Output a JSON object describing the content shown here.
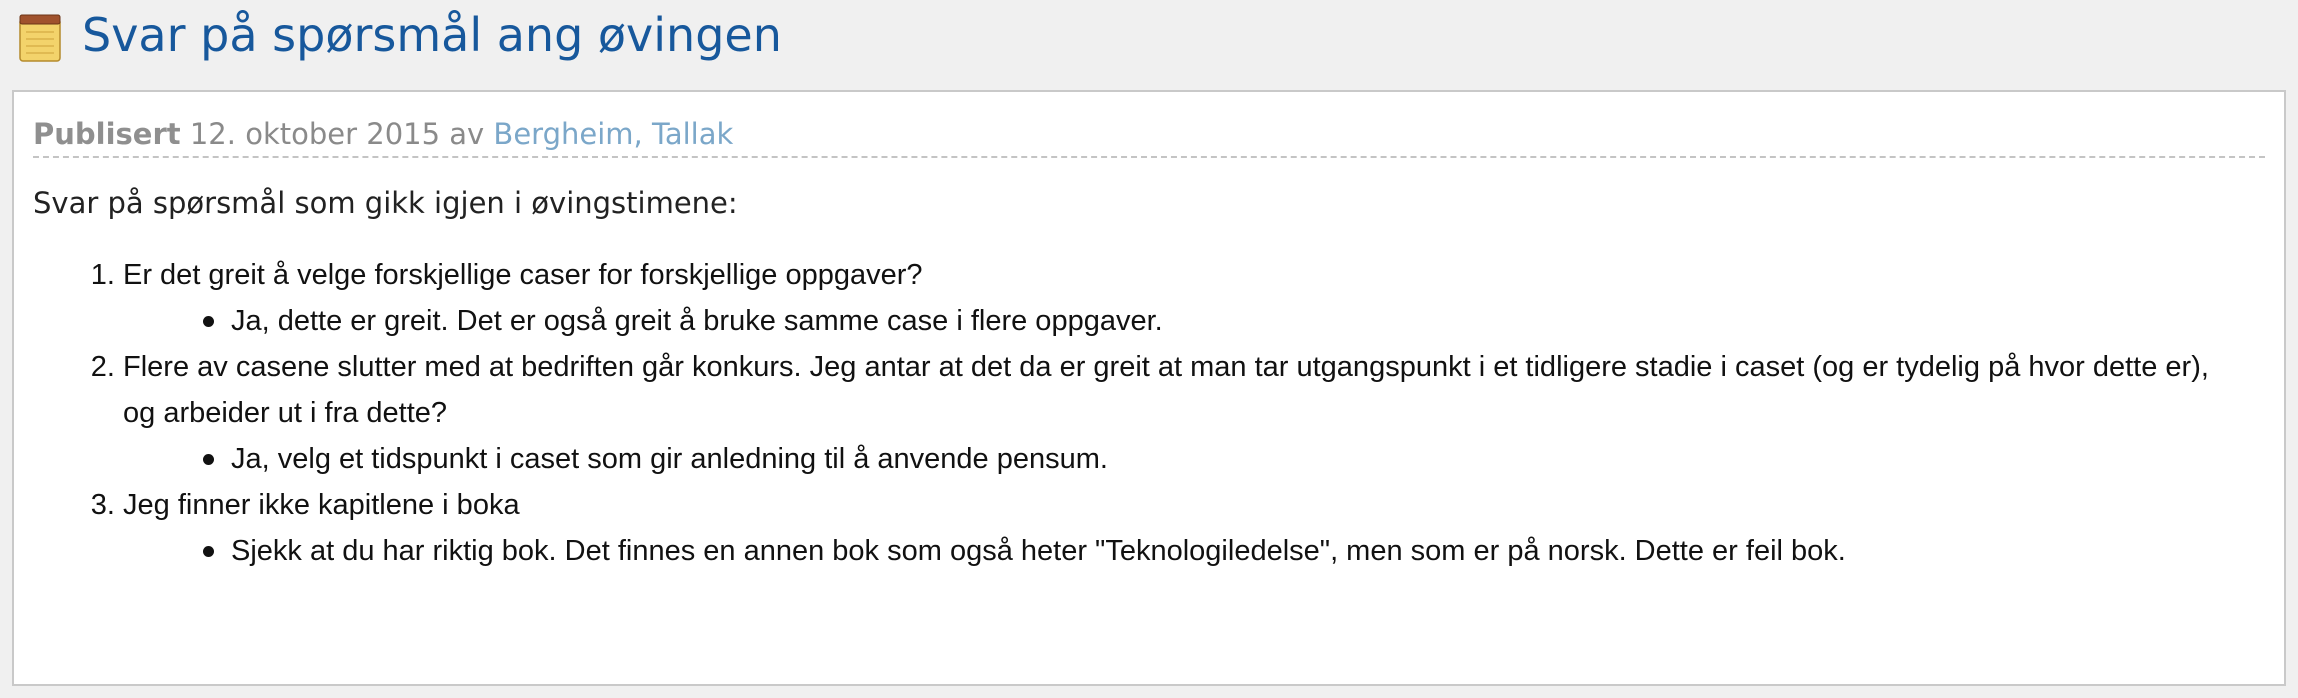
{
  "header": {
    "icon": "notepad-icon",
    "title": "Svar på spørsmål ang øvingen",
    "title_color": "#17589c"
  },
  "post": {
    "published_label": "Publisert",
    "date": "12. oktober 2015",
    "by_label": "av",
    "author": "Bergheim, Tallak",
    "intro": "Svar på spørsmål som gikk igjen i øvingstimene:",
    "items": [
      {
        "question": "Er det greit å velge forskjellige caser for forskjellige oppgaver?",
        "answers": [
          "Ja, dette er greit. Det er også greit å bruke samme case i flere oppgaver."
        ]
      },
      {
        "question": "Flere av casene slutter med at bedriften går konkurs. Jeg antar at det da er greit at man tar utgangspunkt i et tidligere stadie i caset (og er tydelig på hvor dette er), og arbeider ut i fra dette?",
        "answers": [
          "Ja, velg et tidspunkt i caset som gir anledning til å anvende pensum."
        ]
      },
      {
        "question": "Jeg finner ikke kapitlene i boka",
        "answers": [
          "Sjekk at du har riktig bok. Det finnes en annen bok som også heter \"Teknologiledelse\", men som er på norsk. Dette er feil bok."
        ]
      }
    ]
  }
}
